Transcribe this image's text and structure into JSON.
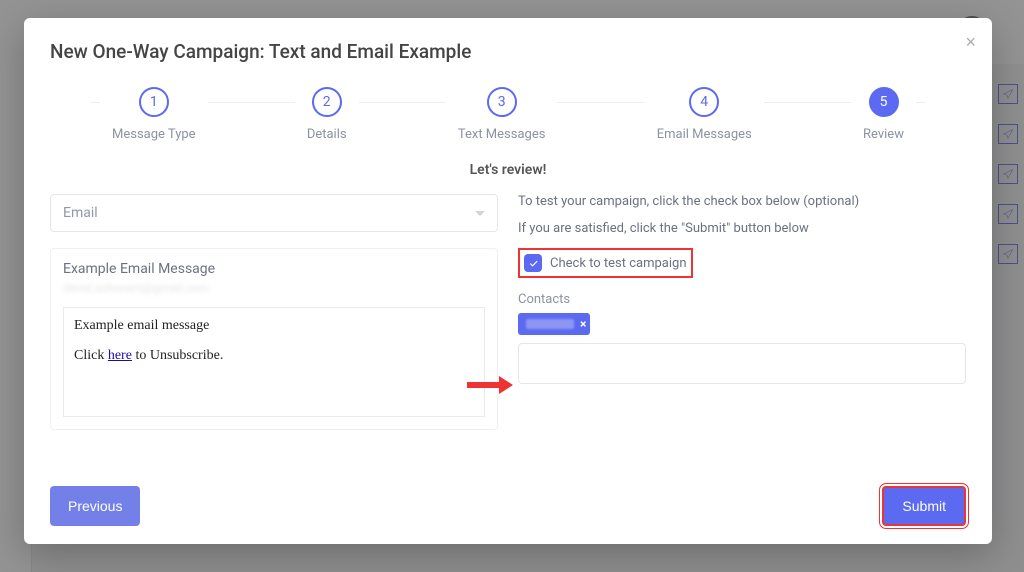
{
  "modal": {
    "title": "New One-Way Campaign: Text and Email Example"
  },
  "stepper": {
    "steps": [
      {
        "num": "1",
        "label": "Message Type"
      },
      {
        "num": "2",
        "label": "Details"
      },
      {
        "num": "3",
        "label": "Text Messages"
      },
      {
        "num": "4",
        "label": "Email Messages"
      },
      {
        "num": "5",
        "label": "Review"
      }
    ]
  },
  "review": {
    "heading": "Let's review!",
    "select_value": "Email",
    "preview": {
      "title": "Example Email Message",
      "from_redacted": "david.schonert@gmail.com",
      "body_line1": "Example email message",
      "body_line2_pre": "Click ",
      "body_line2_link": "here",
      "body_line2_post": " to Unsubscribe."
    },
    "instructions": {
      "line1": "To test your campaign, click the check box below (optional)",
      "line2": "If you are satisfied, click the \"Submit\" button below"
    },
    "check_label": "Check to test campaign",
    "contacts_label": "Contacts"
  },
  "footer": {
    "previous": "Previous",
    "submit": "Submit"
  }
}
